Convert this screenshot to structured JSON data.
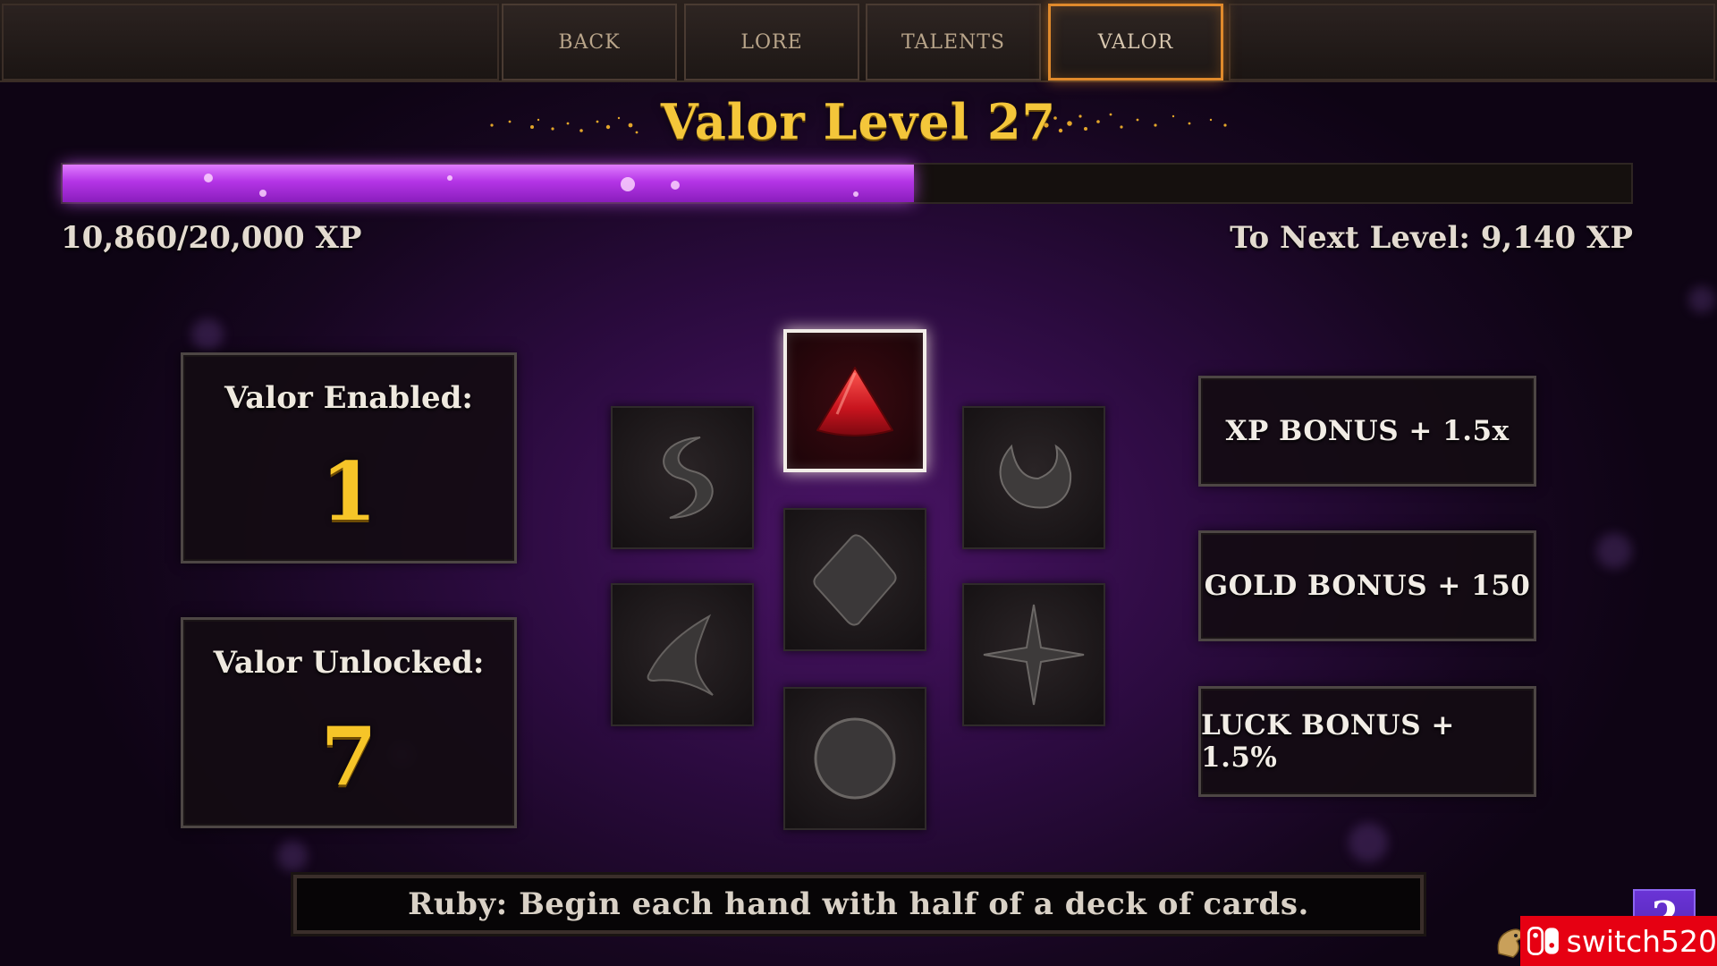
{
  "tabs": [
    {
      "label": "BACK",
      "active": false
    },
    {
      "label": "LORE",
      "active": false
    },
    {
      "label": "TALENTS",
      "active": false
    },
    {
      "label": "VALOR",
      "active": true
    }
  ],
  "title": "Valor Level 27",
  "xp": {
    "current_text": "10,860/20,000 XP",
    "to_next_text": "To Next Level: 9,140 XP",
    "progress_fraction": 0.543
  },
  "stats": {
    "enabled_label": "Valor Enabled:",
    "enabled_value": "1",
    "unlocked_label": "Valor Unlocked:",
    "unlocked_value": "7"
  },
  "gems": [
    {
      "name": "ruby-gem-icon",
      "selected": true
    },
    {
      "name": "crescent-s-gem-icon",
      "selected": false
    },
    {
      "name": "horned-ring-gem-icon",
      "selected": false
    },
    {
      "name": "diamond-gem-icon",
      "selected": false
    },
    {
      "name": "boomerang-gem-icon",
      "selected": false
    },
    {
      "name": "star-gem-icon",
      "selected": false
    },
    {
      "name": "circle-gem-icon",
      "selected": false
    }
  ],
  "bonuses": [
    "XP BONUS + 1.5x",
    "GOLD BONUS + 150",
    "LUCK BONUS + 1.5%"
  ],
  "description": "Ruby: Begin each hand with half of a deck of cards.",
  "help_label": "?",
  "watermark_text": "switch520",
  "colors": {
    "title_gold": "#f4c63a",
    "xp_purple": "#b435e6",
    "active_tab_orange": "#e08a2c",
    "ruby_red": "#d0202a",
    "help_purple": "#5a28c0",
    "watermark_red": "#e60012"
  }
}
